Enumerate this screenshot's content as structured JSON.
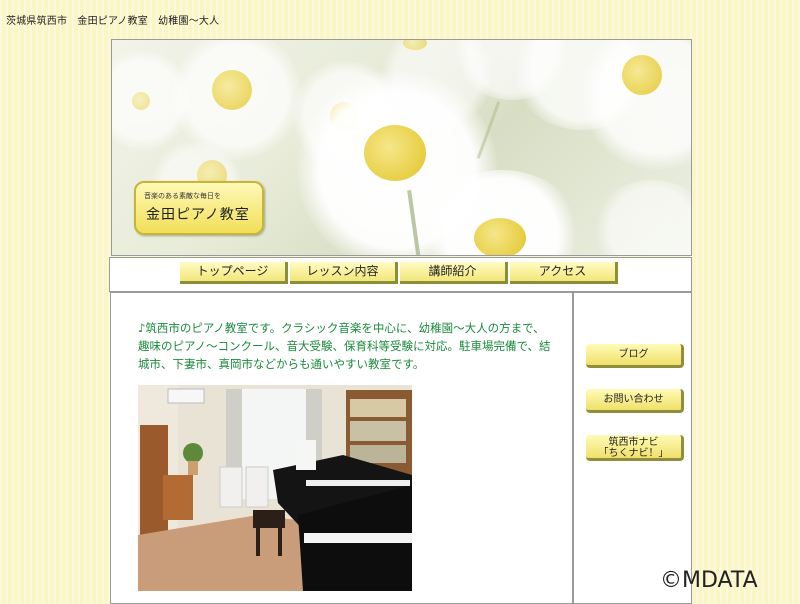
{
  "top_line": "茨城県筑西市　金田ピアノ教室　幼稚園〜大人",
  "logo": {
    "subtitle": "音楽のある素敵な毎日を",
    "title": "金田ピアノ教室"
  },
  "nav": {
    "items": [
      {
        "label": "トップページ"
      },
      {
        "label": "レッスン内容"
      },
      {
        "label": "講師紹介"
      },
      {
        "label": "アクセス"
      }
    ]
  },
  "main": {
    "intro": "♪筑西市のピアノ教室です。クラシック音楽を中心に、幼稚園〜大人の方まで、趣味のピアノ〜コンクール、音大受験、保育科等受験に対応。駐車場完備で、結城市、下妻市、真岡市などからも通いやすい教室です。"
  },
  "sidebar": {
    "buttons": [
      {
        "label": "ブログ"
      },
      {
        "label": "お問い合わせ"
      },
      {
        "label": "筑西市ナビ"
      },
      {
        "label": "「ちくナビ！」"
      }
    ]
  },
  "watermark": "©MDATA",
  "colors": {
    "background": "#fbf6c8",
    "intro_text": "#1a8a3b",
    "button": "#f3e67a"
  }
}
